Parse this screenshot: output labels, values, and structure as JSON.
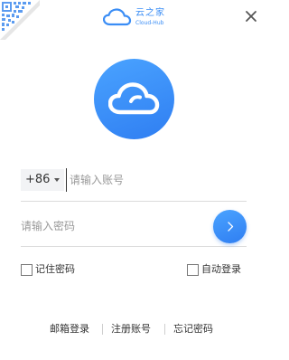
{
  "brand": {
    "name": "云之家",
    "subtitle": "Cloud-Hub",
    "accent_color": "#3a8df5"
  },
  "icons": {
    "qr_corner": "qr-code-icon",
    "close": "close-icon",
    "avatar": "cloud-icon",
    "submit": "chevron-right-icon",
    "country_dropdown": "caret-down-icon"
  },
  "login": {
    "country_code": "+86",
    "phone_placeholder": "请输入账号",
    "password_placeholder": "请输入密码"
  },
  "options": {
    "remember_password": {
      "label": "记住密码",
      "checked": false
    },
    "auto_login": {
      "label": "自动登录",
      "checked": false
    }
  },
  "footer": {
    "email_login": "邮箱登录",
    "register": "注册账号",
    "forgot_password": "忘记密码"
  }
}
